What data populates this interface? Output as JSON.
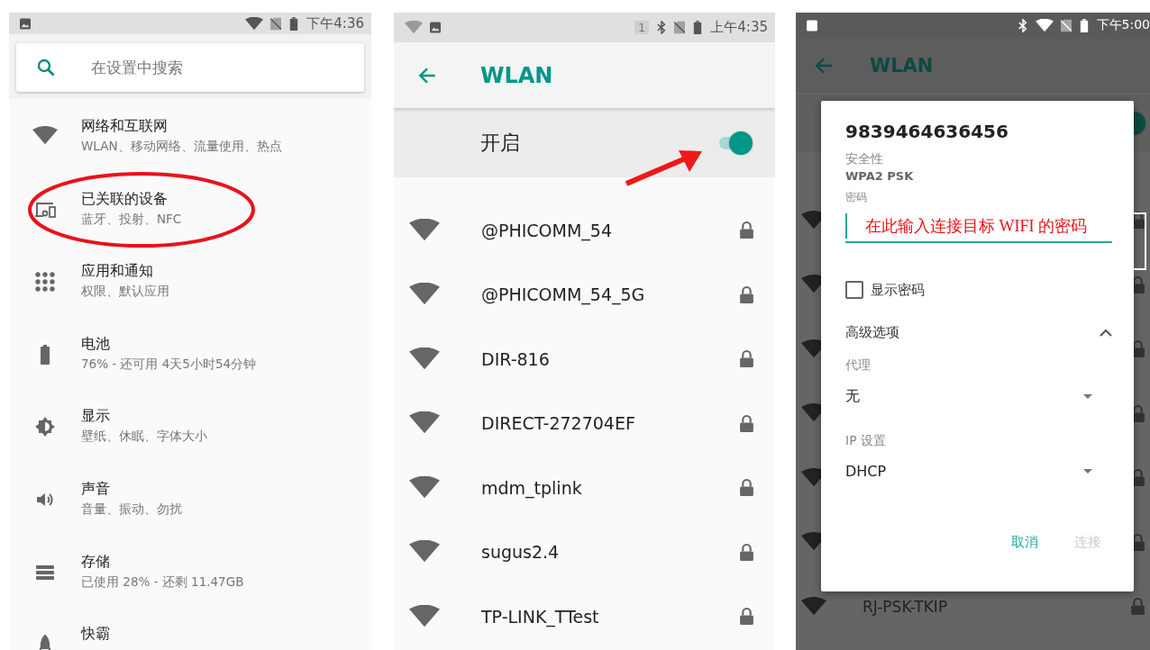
{
  "settings_screen": {
    "status_bar": {
      "time": "下午4:36"
    },
    "search": {
      "placeholder": "在设置中搜索"
    },
    "items": [
      {
        "title": "网络和互联网",
        "subtitle": "WLAN、移动网络、流量使用、热点",
        "circled": false
      },
      {
        "title": "已关联的设备",
        "subtitle": "蓝牙、投射、NFC",
        "circled": true
      },
      {
        "title": "应用和通知",
        "subtitle": "权限、默认应用",
        "circled": false
      },
      {
        "title": "电池",
        "subtitle": "76% - 还可用 4天5小时54分钟",
        "circled": false
      },
      {
        "title": "显示",
        "subtitle": "壁纸、休眠、字体大小",
        "circled": false
      },
      {
        "title": "声音",
        "subtitle": "音量、振动、勿扰",
        "circled": false
      },
      {
        "title": "存储",
        "subtitle": "已使用 28% - 还剩 11.47GB",
        "circled": false
      },
      {
        "title": "快霸",
        "circled": false
      }
    ]
  },
  "wlan_screen": {
    "status_bar": {
      "sim_badge": "1",
      "time": "上午4:35"
    },
    "title": "WLAN",
    "toggle": {
      "label": "开启",
      "on": true
    },
    "networks": [
      {
        "name": "@PHICOMM_54",
        "locked": true
      },
      {
        "name": "@PHICOMM_54_5G",
        "locked": true
      },
      {
        "name": "DIR-816",
        "locked": true
      },
      {
        "name": "DIRECT-272704EF",
        "locked": true
      },
      {
        "name": "mdm_tplink",
        "locked": true
      },
      {
        "name": "sugus2.4",
        "locked": true
      },
      {
        "name": "TP-LINK_TTest",
        "locked": true
      }
    ]
  },
  "dialog_screen": {
    "status_bar": {
      "time": "下午5:00"
    },
    "title": "WLAN",
    "toggle": {
      "on": true
    },
    "networks": [
      {
        "locked": true
      },
      {
        "locked": true
      },
      {
        "locked": true
      },
      {
        "locked": true
      },
      {
        "locked": true
      },
      {
        "locked": true
      },
      {
        "name": "RJ-PSK-TKIP",
        "locked": true
      }
    ],
    "dialog": {
      "title": "9839464636456",
      "security_label": "安全性",
      "security_value": "WPA2 PSK",
      "password_label": "密码",
      "password_annotation": "在此输入连接目标 WIFI 的密码",
      "show_password": {
        "label": "显示密码",
        "checked": false
      },
      "advanced": {
        "label": "高级选项",
        "expanded": true
      },
      "proxy": {
        "label": "代理",
        "value": "无"
      },
      "ip": {
        "label": "IP 设置",
        "value": "DHCP"
      },
      "buttons": [
        {
          "label": "取消",
          "disabled": false
        },
        {
          "label": "连接",
          "disabled": true
        }
      ]
    }
  }
}
